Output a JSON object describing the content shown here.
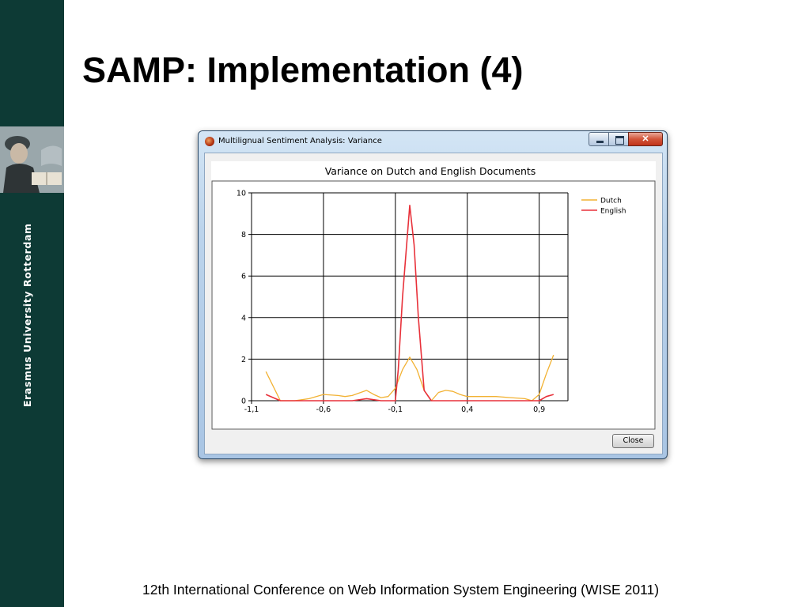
{
  "slide": {
    "title": "SAMP: Implementation (4)",
    "footer": "12th International Conference on Web Information System Engineering (WISE 2011)",
    "university": "Erasmus University Rotterdam"
  },
  "window": {
    "title": "Multilignual Sentiment Analysis: Variance",
    "close_button_label": "Close",
    "app_icon": "app-icon"
  },
  "colors": {
    "band": "#0d3a35",
    "dutch": "#f2b233",
    "english": "#e8313a"
  },
  "chart_data": {
    "type": "line",
    "title": "Variance on Dutch and English Documents",
    "xlabel": "",
    "ylabel": "",
    "xlim": [
      -1.1,
      1.1
    ],
    "ylim": [
      0,
      10
    ],
    "x_ticks": [
      "-1,1",
      "-0,6",
      "-0,1",
      "0,4",
      "0,9"
    ],
    "x_tick_values": [
      -1.1,
      -0.6,
      -0.1,
      0.4,
      0.9
    ],
    "y_ticks": [
      "0",
      "2",
      "4",
      "6",
      "8",
      "10"
    ],
    "y_tick_values": [
      0,
      2,
      4,
      6,
      8,
      10
    ],
    "grid": true,
    "legend_position": "top-right",
    "series": [
      {
        "name": "Dutch",
        "color": "#f2b233",
        "x": [
          -1.0,
          -0.9,
          -0.8,
          -0.7,
          -0.6,
          -0.5,
          -0.45,
          -0.4,
          -0.3,
          -0.25,
          -0.2,
          -0.15,
          -0.1,
          -0.05,
          0.0,
          0.05,
          0.1,
          0.15,
          0.2,
          0.25,
          0.3,
          0.35,
          0.4,
          0.5,
          0.6,
          0.7,
          0.8,
          0.85,
          0.9,
          0.95,
          1.0
        ],
        "values": [
          1.4,
          0.0,
          0.0,
          0.1,
          0.3,
          0.25,
          0.2,
          0.25,
          0.5,
          0.3,
          0.15,
          0.2,
          0.6,
          1.5,
          2.1,
          1.5,
          0.5,
          0.0,
          0.4,
          0.5,
          0.45,
          0.3,
          0.2,
          0.2,
          0.2,
          0.15,
          0.1,
          0.0,
          0.3,
          1.3,
          2.2
        ]
      },
      {
        "name": "English",
        "color": "#e8313a",
        "x": [
          -1.0,
          -0.9,
          -0.8,
          -0.4,
          -0.3,
          -0.2,
          -0.1,
          -0.08,
          -0.05,
          0.0,
          0.03,
          0.06,
          0.1,
          0.15,
          0.2,
          0.8,
          0.9,
          0.95,
          1.0
        ],
        "values": [
          0.3,
          0.0,
          0.0,
          0.0,
          0.1,
          0.0,
          0.0,
          1.5,
          5.0,
          9.4,
          7.5,
          4.0,
          0.5,
          0.0,
          0.0,
          0.0,
          0.0,
          0.2,
          0.3
        ]
      }
    ]
  }
}
